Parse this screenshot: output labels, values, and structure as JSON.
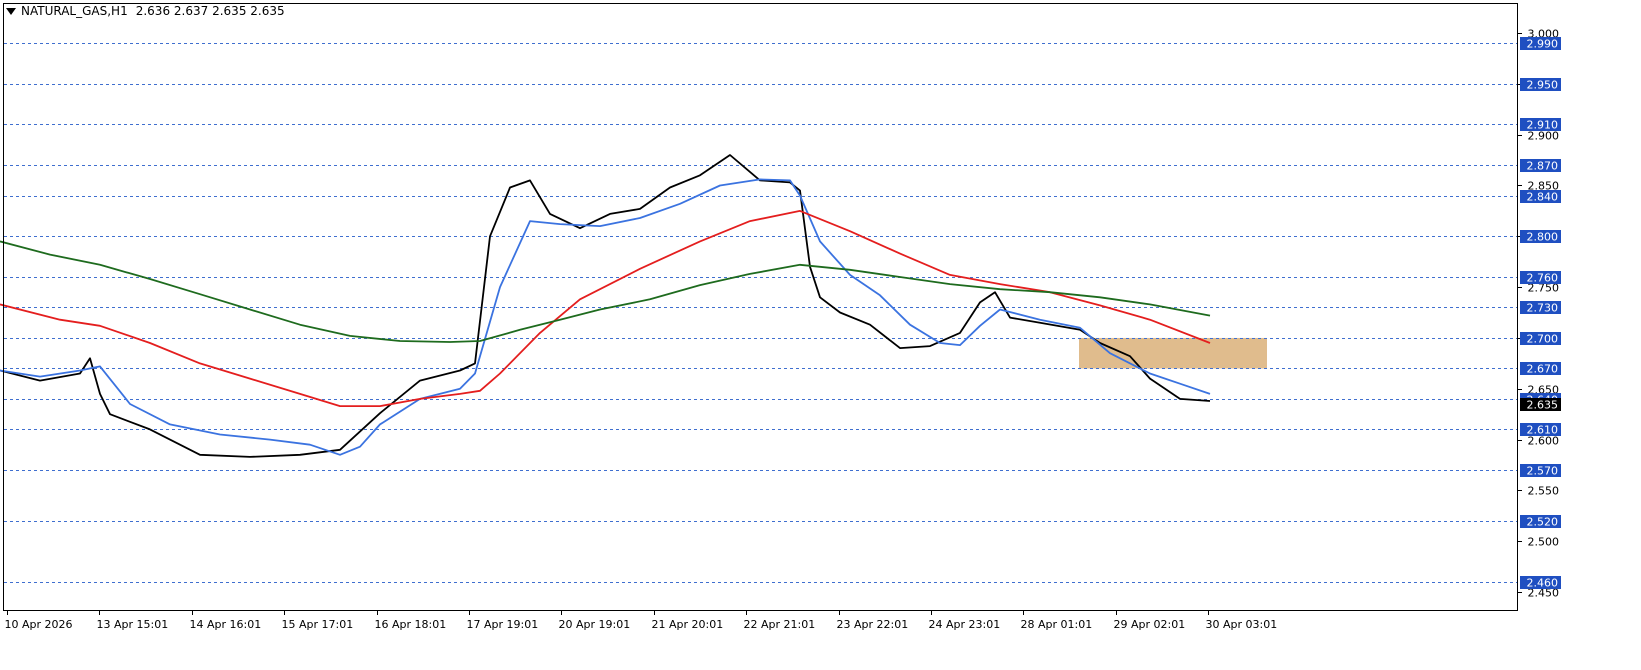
{
  "header": {
    "symbol": "NATURAL_GAS,H1",
    "open": "2.636",
    "high": "2.637",
    "low": "2.635",
    "close": "2.635"
  },
  "colors": {
    "background": "#ffffff",
    "grid_line": "#3f6fcf",
    "level_label_bg": "#1f4fc1",
    "level_label_text": "#ffffff",
    "price_label_bg": "#000000",
    "price_label_text": "#ffffff",
    "candle": "#000000",
    "ma_fast": "#000000",
    "ma_blue": "#3b73e0",
    "ma_red": "#e41e1e",
    "ma_green": "#1e6b1e",
    "zone": "#deb887"
  },
  "chart_data": {
    "type": "line",
    "title": "NATURAL_GAS,H1",
    "ylim": [
      2.435,
      3.023
    ],
    "grid": false,
    "legend": "none",
    "price_axis_ticks": [
      "3.000",
      "2.950",
      "2.900",
      "2.850",
      "2.800",
      "2.750",
      "2.700",
      "2.650",
      "2.600",
      "2.550",
      "2.500",
      "2.450"
    ],
    "x_tick_labels": [
      "10 Apr 2026",
      "13 Apr 15:01",
      "14 Apr 16:01",
      "15 Apr 17:01",
      "16 Apr 18:01",
      "17 Apr 19:01",
      "20 Apr 19:01",
      "21 Apr 20:01",
      "22 Apr 21:01",
      "23 Apr 22:01",
      "24 Apr 23:01",
      "28 Apr 01:01",
      "29 Apr 02:01",
      "30 Apr 03:01"
    ],
    "horizontal_levels": [
      "2.990",
      "2.950",
      "2.910",
      "2.870",
      "2.840",
      "2.800",
      "2.760",
      "2.730",
      "2.700",
      "2.670",
      "2.640",
      "2.610",
      "2.570",
      "2.520",
      "2.460"
    ],
    "current_price": "2.635",
    "zone": {
      "x_start": 1079,
      "x_end": 1267,
      "y_high": 2.7,
      "y_low": 2.67
    },
    "series": [
      {
        "color": "#000000",
        "x": [
          0,
          40,
          80,
          90,
          100,
          110,
          150,
          200,
          250,
          300,
          340,
          380,
          420,
          460,
          475,
          490,
          510,
          530,
          550,
          580,
          610,
          640,
          670,
          700,
          730,
          760,
          790,
          800,
          810,
          820,
          840,
          870,
          900,
          930,
          960,
          980,
          995,
          1010,
          1040,
          1080,
          1100,
          1130,
          1150,
          1180,
          1210
        ],
        "y": [
          2.668,
          2.658,
          2.665,
          2.68,
          2.645,
          2.625,
          2.61,
          2.585,
          2.583,
          2.585,
          2.59,
          2.626,
          2.658,
          2.668,
          2.675,
          2.8,
          2.848,
          2.855,
          2.822,
          2.808,
          2.822,
          2.827,
          2.848,
          2.86,
          2.88,
          2.855,
          2.853,
          2.845,
          2.77,
          2.74,
          2.725,
          2.713,
          2.69,
          2.692,
          2.705,
          2.735,
          2.745,
          2.72,
          2.715,
          2.708,
          2.695,
          2.682,
          2.66,
          2.64,
          2.638
        ]
      },
      {
        "color": "#3b73e0",
        "x": [
          0,
          40,
          80,
          100,
          130,
          170,
          220,
          270,
          310,
          340,
          360,
          380,
          420,
          460,
          475,
          500,
          530,
          560,
          600,
          640,
          680,
          720,
          760,
          790,
          800,
          820,
          850,
          880,
          910,
          940,
          960,
          980,
          1000,
          1040,
          1080,
          1110,
          1150,
          1180,
          1210
        ],
        "y": [
          2.668,
          2.662,
          2.668,
          2.672,
          2.635,
          2.615,
          2.605,
          2.6,
          2.595,
          2.585,
          2.593,
          2.615,
          2.64,
          2.65,
          2.665,
          2.75,
          2.815,
          2.812,
          2.81,
          2.818,
          2.832,
          2.85,
          2.856,
          2.855,
          2.84,
          2.795,
          2.762,
          2.742,
          2.713,
          2.695,
          2.693,
          2.712,
          2.728,
          2.718,
          2.71,
          2.685,
          2.665,
          2.655,
          2.645
        ]
      },
      {
        "color": "#e41e1e",
        "x": [
          0,
          60,
          100,
          150,
          200,
          250,
          300,
          340,
          380,
          420,
          460,
          480,
          500,
          540,
          580,
          640,
          700,
          750,
          800,
          850,
          900,
          950,
          1000,
          1050,
          1100,
          1150,
          1210
        ],
        "y": [
          2.733,
          2.718,
          2.712,
          2.695,
          2.675,
          2.66,
          2.645,
          2.633,
          2.633,
          2.64,
          2.645,
          2.648,
          2.665,
          2.705,
          2.738,
          2.768,
          2.795,
          2.815,
          2.825,
          2.805,
          2.783,
          2.762,
          2.753,
          2.745,
          2.732,
          2.718,
          2.695
        ]
      },
      {
        "color": "#1e6b1e",
        "x": [
          0,
          50,
          100,
          150,
          200,
          250,
          300,
          350,
          400,
          450,
          480,
          520,
          560,
          600,
          650,
          700,
          750,
          800,
          850,
          900,
          950,
          1000,
          1050,
          1100,
          1150,
          1210
        ],
        "y": [
          2.795,
          2.782,
          2.772,
          2.758,
          2.743,
          2.728,
          2.713,
          2.702,
          2.697,
          2.696,
          2.697,
          2.708,
          2.718,
          2.728,
          2.738,
          2.752,
          2.763,
          2.772,
          2.767,
          2.76,
          2.753,
          2.748,
          2.745,
          2.74,
          2.733,
          2.722
        ]
      }
    ]
  }
}
